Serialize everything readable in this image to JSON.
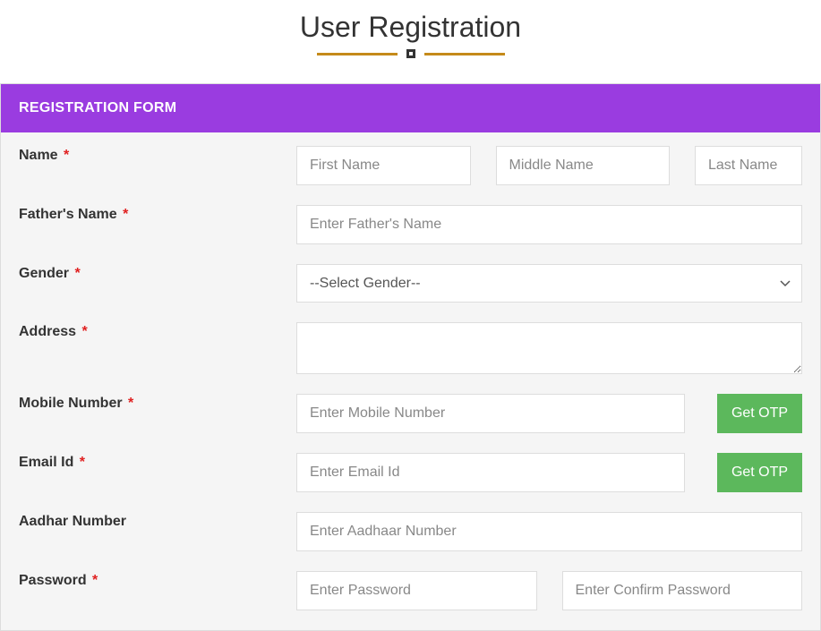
{
  "page": {
    "title": "User Registration"
  },
  "form": {
    "header": "REGISTRATION FORM",
    "name": {
      "label": "Name",
      "first_placeholder": "First Name",
      "middle_placeholder": "Middle Name",
      "last_placeholder": "Last Name"
    },
    "father": {
      "label": "Father's Name",
      "placeholder": "Enter Father's Name"
    },
    "gender": {
      "label": "Gender",
      "placeholder_option": "--Select Gender--"
    },
    "address": {
      "label": "Address"
    },
    "mobile": {
      "label": "Mobile Number",
      "placeholder": "Enter Mobile Number",
      "otp_button": "Get OTP"
    },
    "email": {
      "label": "Email Id",
      "placeholder": "Enter Email Id",
      "otp_button": "Get OTP"
    },
    "aadhar": {
      "label": "Aadhar Number",
      "placeholder": "Enter Aadhaar Number"
    },
    "password": {
      "label": "Password",
      "placeholder": "Enter Password",
      "confirm_placeholder": "Enter Confirm Password"
    }
  }
}
